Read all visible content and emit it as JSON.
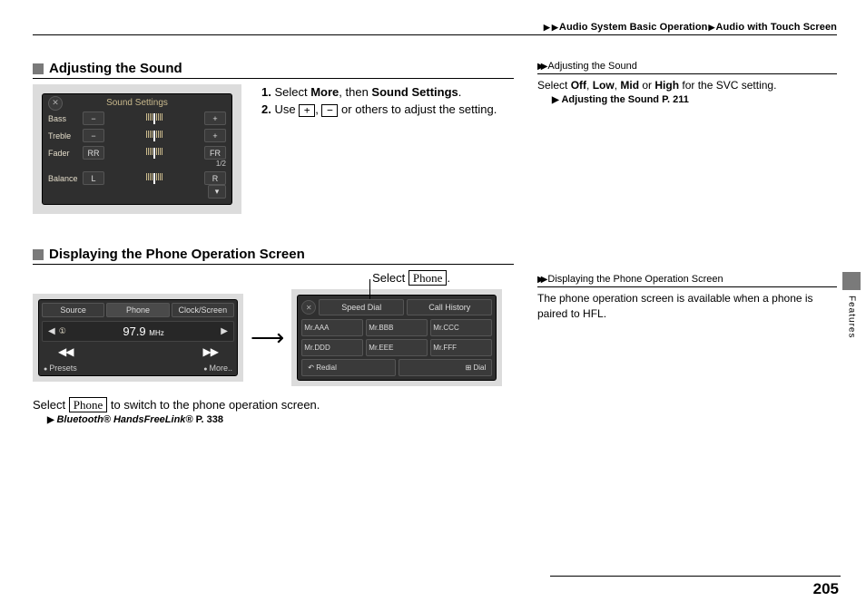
{
  "breadcrumb": {
    "a": "Audio System Basic Operation",
    "b": "Audio with Touch Screen"
  },
  "section1": {
    "title": "Adjusting the Sound",
    "step1_pre": "Select ",
    "step1_b1": "More",
    "step1_mid": ", then ",
    "step1_b2": "Sound Settings",
    "step1_post": ".",
    "step2_pre": "Use ",
    "key_plus": "+",
    "step2_comma": ", ",
    "key_minus": "−",
    "step2_post": " or others to adjust the setting."
  },
  "sound_screen": {
    "title": "Sound Settings",
    "rows": [
      {
        "label": "Bass",
        "l": "−",
        "r": "+"
      },
      {
        "label": "Treble",
        "l": "−",
        "r": "+"
      },
      {
        "label": "Fader",
        "l": "RR",
        "r": "FR"
      },
      {
        "label": "Balance",
        "l": "L",
        "r": "R"
      }
    ],
    "page": "1/2"
  },
  "section2": {
    "title": "Displaying the Phone Operation Screen",
    "callout_pre": "Select ",
    "phone_btn": "Phone",
    "callout_post": ".",
    "foot_pre": "Select ",
    "foot_post": " to switch to the phone operation screen.",
    "ref": "Bluetooth® HandsFreeLink®",
    "ref_page": "P. 338"
  },
  "radio_screen": {
    "tabs": [
      "Source",
      "Phone",
      "Clock/Screen"
    ],
    "freq": "97.9",
    "unit": "MHz",
    "bottom": [
      "Presets",
      "More.."
    ]
  },
  "phone_screen": {
    "tabs": [
      "Speed Dial",
      "Call History"
    ],
    "cells": [
      "Mr.AAA",
      "Mr.BBB",
      "Mr.CCC",
      "Mr.DDD",
      "Mr.EEE",
      "Mr.FFF"
    ],
    "redial": "Redial",
    "dial": "Dial"
  },
  "side1": {
    "head": "Adjusting the Sound",
    "body_pre": "Select ",
    "b1": "Off",
    "c1": ", ",
    "b2": "Low",
    "c2": ", ",
    "b3": "Mid",
    "c3": " or ",
    "b4": "High",
    "body_post": " for the SVC setting.",
    "ref": "Adjusting the Sound",
    "ref_page": "P. 211"
  },
  "side2": {
    "head": "Displaying the Phone Operation Screen",
    "body": "The phone operation screen is available when a phone is paired to HFL."
  },
  "side_tab": "Features",
  "page_number": "205"
}
